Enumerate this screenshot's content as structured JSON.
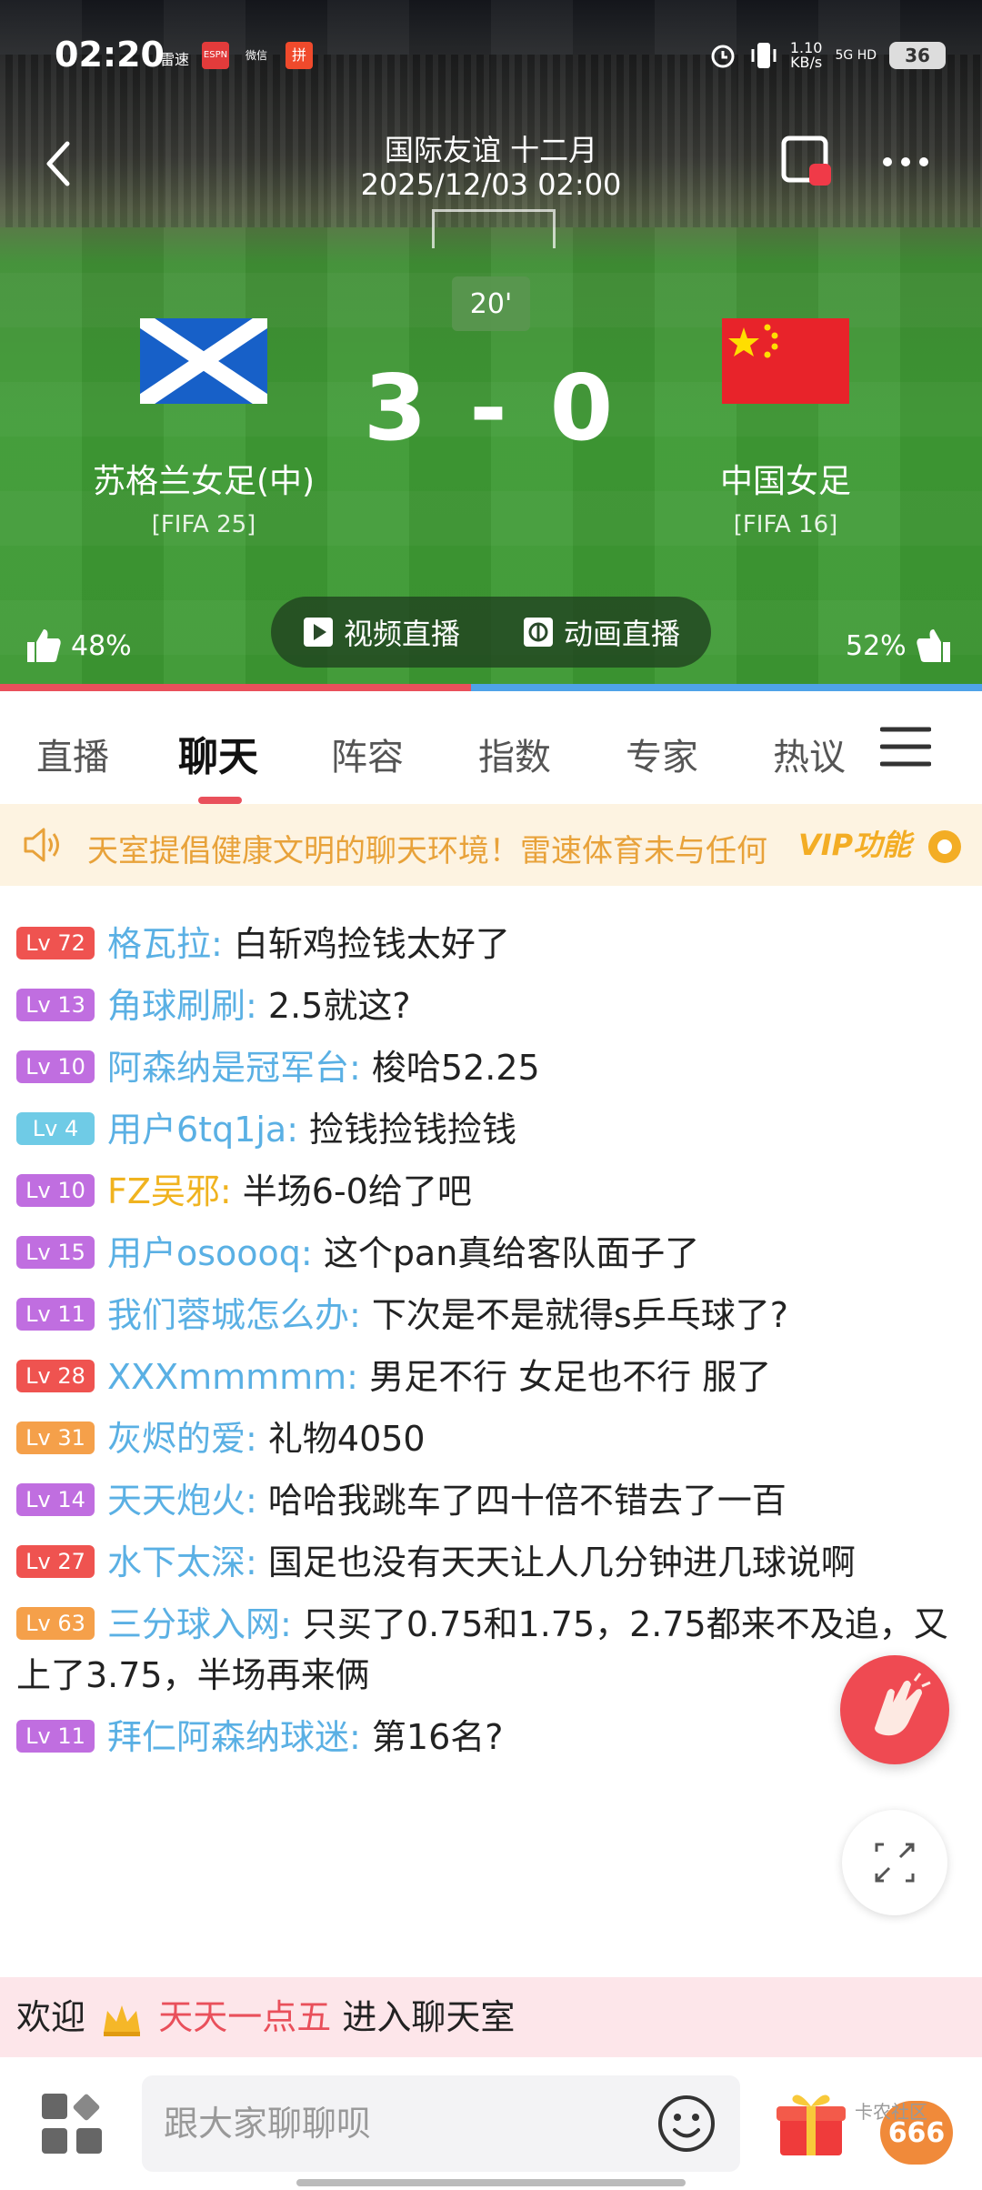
{
  "status_bar": {
    "time": "02:20",
    "apps": [
      "雷速",
      "ESPN",
      "微信",
      "拼"
    ],
    "speed": "1.10\nKB/s",
    "network": "5G HD",
    "battery": "36"
  },
  "match": {
    "title": "国际友谊 十二月",
    "datetime": "2025/12/03 02:00",
    "minute": "20'",
    "score_home": "3",
    "score_sep": "-",
    "score_away": "0",
    "home": {
      "name": "苏格兰女足(中)",
      "rank": "[FIFA 25]"
    },
    "away": {
      "name": "中国女足",
      "rank": "[FIFA 16]"
    },
    "home_support": "48%",
    "away_support": "52%",
    "home_support_fraction": 0.48,
    "live_video_label": "视频直播",
    "live_animation_label": "动画直播"
  },
  "tabs": [
    {
      "label": "直播"
    },
    {
      "label": "聊天",
      "active": true
    },
    {
      "label": "阵容"
    },
    {
      "label": "指数"
    },
    {
      "label": "专家"
    },
    {
      "label": "热议"
    }
  ],
  "notice": {
    "text": "天室提倡健康文明的聊天环境！雷速体育未与任何",
    "vip_label": "VIP功能"
  },
  "chat": {
    "messages": [
      {
        "level": "Lv 72",
        "level_color": "#ef5350",
        "user": "格瓦拉:",
        "user_color": "#5ab0e4",
        "text": "白斩鸡捡钱太好了"
      },
      {
        "level": "Lv 13",
        "level_color": "#c06ee0",
        "user": "角球刷刷:",
        "user_color": "#5ab0e4",
        "text": "2.5就这?"
      },
      {
        "level": "Lv 10",
        "level_color": "#c06ee0",
        "user": "阿森纳是冠军台:",
        "user_color": "#5ab0e4",
        "text": "梭哈52.25"
      },
      {
        "level": "Lv 4",
        "level_color": "#6fcbe6",
        "user": "用户6tq1ja:",
        "user_color": "#5ab0e4",
        "text": "捡钱捡钱捡钱"
      },
      {
        "level": "Lv 10",
        "level_color": "#c06ee0",
        "user": "FZ吴邪:",
        "user_color": "#f0b31f",
        "text": "半场6-0给了吧"
      },
      {
        "level": "Lv 15",
        "level_color": "#c06ee0",
        "user": "用户osoooq:",
        "user_color": "#5ab0e4",
        "text": "这个pan真给客队面子了"
      },
      {
        "level": "Lv 11",
        "level_color": "#c06ee0",
        "user": "我们蓉城怎么办:",
        "user_color": "#5ab0e4",
        "text": "下次是不是就得s乒乓球了?"
      },
      {
        "level": "Lv 28",
        "level_color": "#ef5350",
        "user": "XXXmmmmm:",
        "user_color": "#5ab0e4",
        "text": "男足不行 女足也不行 服了"
      },
      {
        "level": "Lv 31",
        "level_color": "#f5a04a",
        "user": "灰烬的爱:",
        "user_color": "#5ab0e4",
        "text": "礼物4050"
      },
      {
        "level": "Lv 14",
        "level_color": "#c06ee0",
        "user": "天天炮火:",
        "user_color": "#5ab0e4",
        "text": "哈哈我跳车了四十倍不错去了一百"
      },
      {
        "level": "Lv 27",
        "level_color": "#ef5350",
        "user": "水下太深:",
        "user_color": "#5ab0e4",
        "text": "国足也没有天天让人几分钟进几球说啊"
      },
      {
        "level": "Lv 63",
        "level_color": "#f5a04a",
        "user": "三分球入网:",
        "user_color": "#5ab0e4",
        "text": "只买了0.75和1.75，2.75都来不及追，又上了3.75，半场再来俩"
      },
      {
        "level": "Lv 11",
        "level_color": "#c06ee0",
        "user": "拜仁阿森纳球迷:",
        "user_color": "#5ab0e4",
        "text": "第16名?"
      }
    ]
  },
  "welcome": {
    "prefix": "欢迎",
    "user": "天天一点五",
    "suffix": "进入聊天室"
  },
  "input": {
    "placeholder": "跟大家聊聊呗"
  },
  "gift_badge": "666",
  "watermark": "卡农社区"
}
